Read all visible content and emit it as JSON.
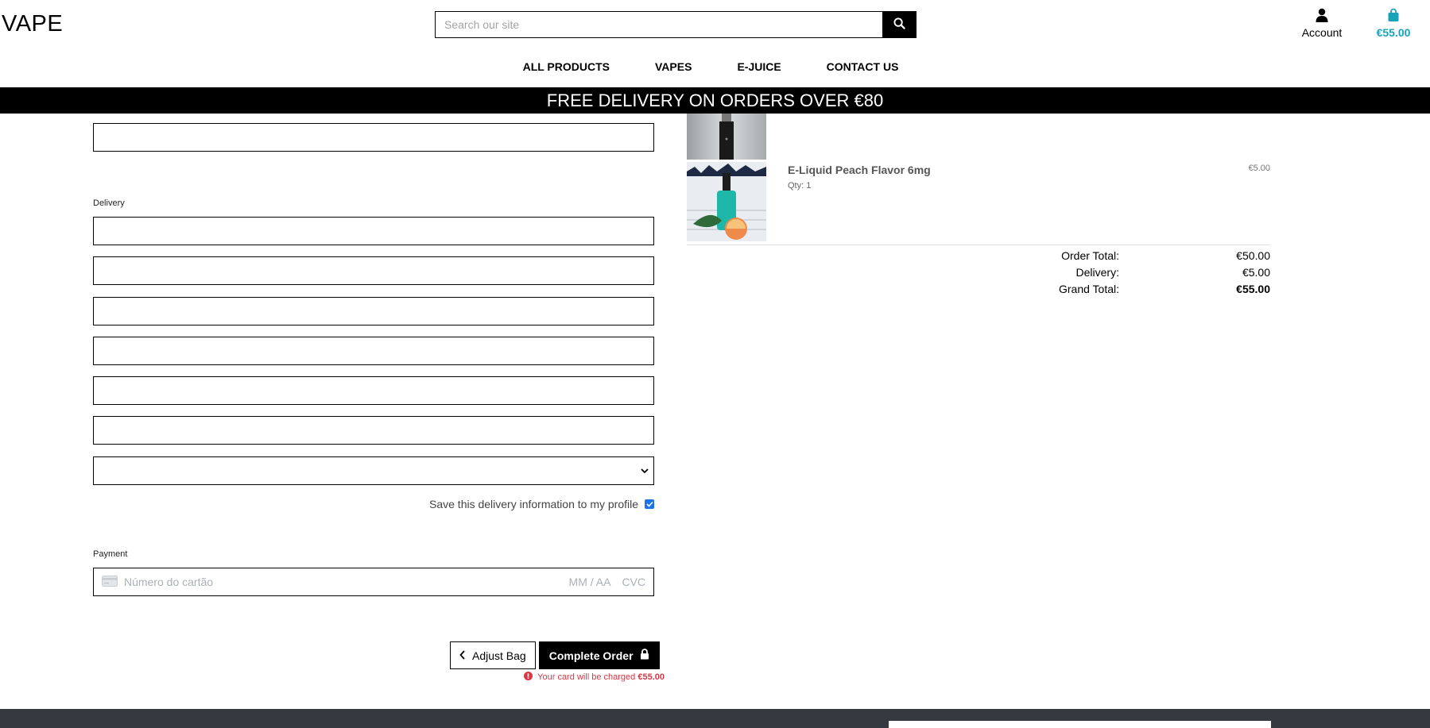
{
  "brand": {
    "logo": "VAPE"
  },
  "search": {
    "placeholder": "Search our site"
  },
  "account": {
    "label": "Account"
  },
  "bag": {
    "total": "€55.00"
  },
  "nav": {
    "items": [
      "ALL PRODUCTS",
      "VAPES",
      "E-JUICE",
      "CONTACT US"
    ]
  },
  "banner": {
    "text": "FREE DELIVERY ON ORDERS OVER €80"
  },
  "form": {
    "delivery_label": "Delivery",
    "payment_label": "Payment",
    "save_info_label": "Save this delivery information to my profile",
    "save_info_checked": true,
    "card": {
      "number_placeholder": "Número do cartão",
      "expiry_placeholder": "MM / AA",
      "cvc_placeholder": "CVC"
    }
  },
  "actions": {
    "adjust_bag": "Adjust Bag",
    "complete_order": "Complete Order",
    "charge_note": "Your card will be charged",
    "charge_amount": "€55.00"
  },
  "order": {
    "items": [
      {
        "name": "E-Liquid Peach Flavor 6mg",
        "qty": "Qty: 1",
        "price": "€5.00"
      }
    ],
    "totals": [
      {
        "label": "Order Total:",
        "value": "€50.00"
      },
      {
        "label": "Delivery:",
        "value": "€5.00"
      },
      {
        "label": "Grand Total:",
        "value": "€55.00"
      }
    ]
  },
  "colors": {
    "accent": "#17a2b8",
    "error": "#dc3545",
    "footer": "#343a40"
  },
  "icons": {
    "search": "search-icon",
    "account": "user-icon",
    "bag": "shopping-bag-icon",
    "lock": "lock-icon",
    "back": "chevron-left-icon",
    "alert": "exclamation-circle-icon",
    "card": "credit-card-icon",
    "dropdown": "chevron-down-icon"
  }
}
